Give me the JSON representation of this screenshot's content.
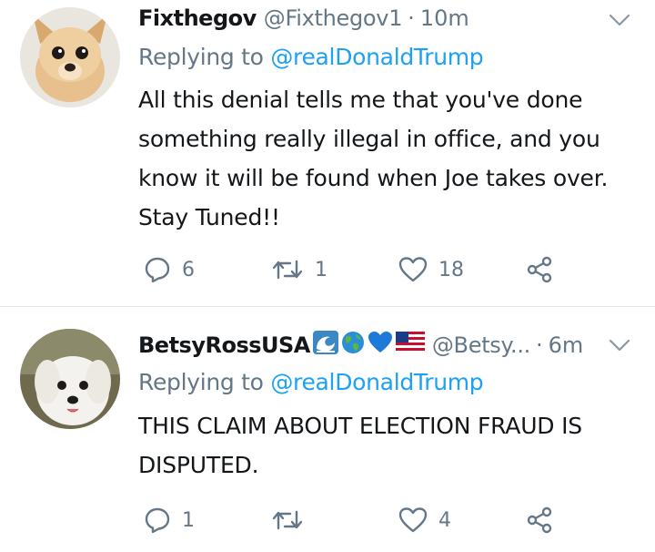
{
  "tweets": [
    {
      "name": "Fixthegov",
      "handle": "@Fixthegov1",
      "separator": "·",
      "time": "10m",
      "replying_prefix": "Replying to",
      "replying_to": "@realDonaldTrump",
      "text": "All this denial tells me that you've done\nsomething really illegal in office, and you\nknow it will be found when Joe takes over.\nStay Tuned!!",
      "replies": "6",
      "retweets": "1",
      "likes": "18"
    },
    {
      "name": "BetsyRossUSA",
      "name_emoji": [
        "wave-emoji",
        "globe-emoji",
        "blue-heart-emoji",
        "us-flag-emoji"
      ],
      "handle": "@Betsy...",
      "separator": "·",
      "time": "6m",
      "replying_prefix": "Replying to",
      "replying_to": "@realDonaldTrump",
      "text": "THIS CLAIM ABOUT ELECTION FRAUD IS\nDISPUTED.",
      "replies": "1",
      "retweets": "",
      "likes": "4"
    }
  ],
  "colors": {
    "text": "#14171a",
    "secondary": "#657786",
    "link": "#1da1f2",
    "divider": "#e1e8ed"
  }
}
